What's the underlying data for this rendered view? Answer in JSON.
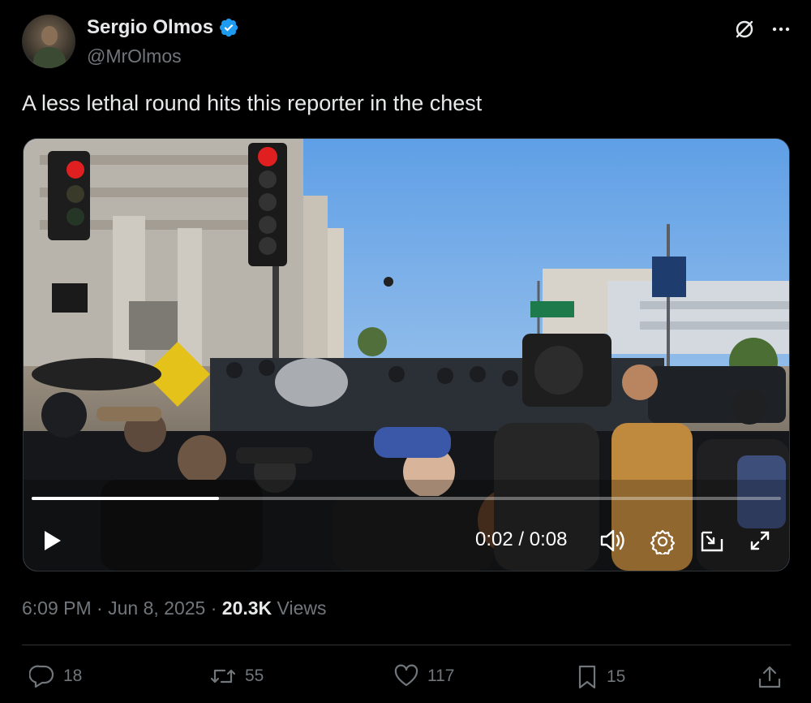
{
  "author": {
    "display_name": "Sergio Olmos",
    "handle": "@MrOlmos",
    "verified": true,
    "verified_color": "#1d9bf0"
  },
  "tweet": {
    "text": "A less lethal round hits this reporter in the chest"
  },
  "video": {
    "time_readout": "0:02 / 0:08",
    "progress_fraction": 0.25,
    "controls": [
      "play-icon",
      "volume-icon",
      "settings-icon",
      "pip-icon",
      "fullscreen-icon"
    ]
  },
  "meta": {
    "time": "6:09 PM",
    "date": "Jun 8, 2025",
    "views_count": "20.3K",
    "views_label": "Views"
  },
  "actions": {
    "replies": "18",
    "reposts": "55",
    "likes": "117",
    "bookmarks": "15"
  },
  "colors": {
    "background": "#000000",
    "text_primary": "#e7e9ea",
    "text_secondary": "#71767b",
    "accent": "#1d9bf0"
  }
}
